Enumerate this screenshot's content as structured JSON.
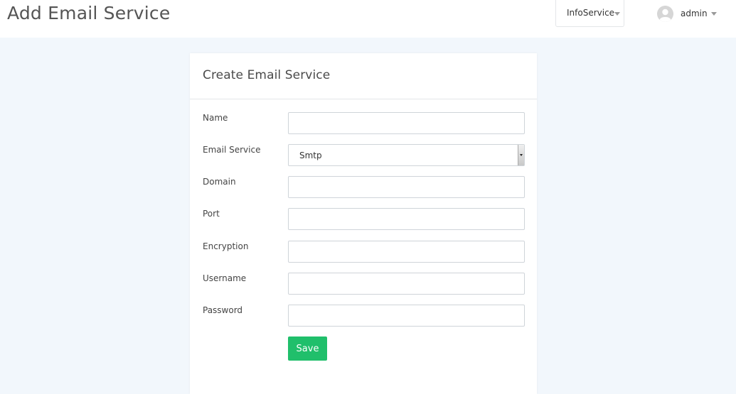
{
  "header": {
    "title": "Add Email Service",
    "tenant_dropdown": {
      "label": "InfoService",
      "icon": "chevron-down-icon"
    },
    "user_menu": {
      "name": "admin",
      "avatar_icon": "user-avatar-icon",
      "caret_icon": "chevron-down-icon"
    }
  },
  "form": {
    "title": "Create Email Service",
    "fields": {
      "name": {
        "label": "Name",
        "value": "",
        "placeholder": ""
      },
      "email_service": {
        "label": "Email Service",
        "selected": "Smtp"
      },
      "domain": {
        "label": "Domain",
        "value": "",
        "placeholder": ""
      },
      "port": {
        "label": "Port",
        "value": "",
        "placeholder": ""
      },
      "encryption": {
        "label": "Encryption",
        "value": "",
        "placeholder": ""
      },
      "username": {
        "label": "Username",
        "value": "",
        "placeholder": ""
      },
      "password": {
        "label": "Password",
        "value": "",
        "placeholder": ""
      }
    },
    "save_label": "Save"
  },
  "colors": {
    "page_background": "#f2f7fc",
    "save_button": "#20bf6b"
  }
}
